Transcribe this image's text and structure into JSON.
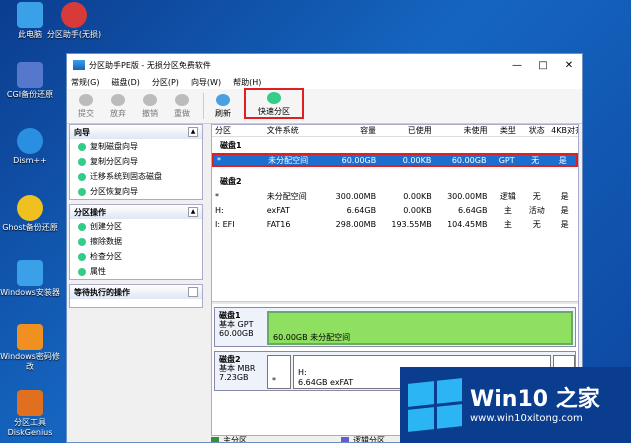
{
  "desktop": {
    "icons": [
      {
        "label": "此电脑",
        "color": "#3aa0e8"
      },
      {
        "label": "分区助手(无损)",
        "color": "#d83a3a"
      },
      {
        "label": "CGI备份还原",
        "color": "#5577cc"
      },
      {
        "label": "Dism++",
        "color": "#2a8fe0"
      },
      {
        "label": "Ghost备份还原",
        "color": "#f0c020"
      },
      {
        "label": "Windows安装器",
        "color": "#3aa0e8"
      },
      {
        "label": "Windows密码修改",
        "color": "#f09020"
      },
      {
        "label": "分区工具DiskGenius",
        "color": "#e07020"
      }
    ]
  },
  "window": {
    "title": "分区助手PE版 - 无损分区免费软件",
    "controls": {
      "min": "—",
      "max": "□",
      "close": "✕"
    },
    "menu": [
      "常规(G)",
      "磁盘(D)",
      "分区(P)",
      "向导(W)",
      "帮助(H)"
    ],
    "toolbar": {
      "submit": "提交",
      "discard": "放弃",
      "undo": "撤销",
      "redo": "重做",
      "refresh": "刷新",
      "quick": "快速分区"
    },
    "wizard": {
      "title": "向导",
      "items": [
        "复制磁盘向导",
        "复制分区向导",
        "迁移系统到固态磁盘",
        "分区恢复向导"
      ]
    },
    "partition_ops": {
      "title": "分区操作",
      "items": [
        "创建分区",
        "擦除数据",
        "检查分区",
        "属性"
      ]
    },
    "pending": {
      "title": "等待执行的操作"
    },
    "table": {
      "headers": [
        "分区",
        "文件系统",
        "容量",
        "已使用",
        "未使用",
        "类型",
        "状态",
        "4KB对齐"
      ],
      "disk1": {
        "name": "磁盘1",
        "rows": [
          [
            "*",
            "未分配空间",
            "60.00GB",
            "0.00KB",
            "60.00GB",
            "GPT",
            "无",
            "是"
          ]
        ]
      },
      "disk2": {
        "name": "磁盘2",
        "rows": [
          [
            "*",
            "未分配空间",
            "300.00MB",
            "0.00KB",
            "300.00MB",
            "逻辑",
            "无",
            "是"
          ],
          [
            "H:",
            "exFAT",
            "6.64GB",
            "0.00KB",
            "6.64GB",
            "主",
            "活动",
            "是"
          ],
          [
            "I: EFI",
            "FAT16",
            "298.00MB",
            "193.55MB",
            "104.45MB",
            "主",
            "无",
            "是"
          ]
        ]
      }
    },
    "diskmap": {
      "d1": {
        "name": "磁盘1",
        "type": "基本 GPT",
        "size": "60.00GB",
        "bar": "60.00GB 未分配空间"
      },
      "d2": {
        "name": "磁盘2",
        "type": "基本 MBR",
        "size": "7.23GB",
        "p1": "*",
        "p2": "H:",
        "p2info": "6.64GB exFAT",
        "p3": "I"
      }
    },
    "legend": {
      "primary": "主分区",
      "logical": "逻辑分区",
      "primary_color": "#3a8f3a",
      "logical_color": "#6a5acd"
    }
  },
  "logo": {
    "title": "Win10 之家",
    "url": "www.win10xitong.com"
  }
}
